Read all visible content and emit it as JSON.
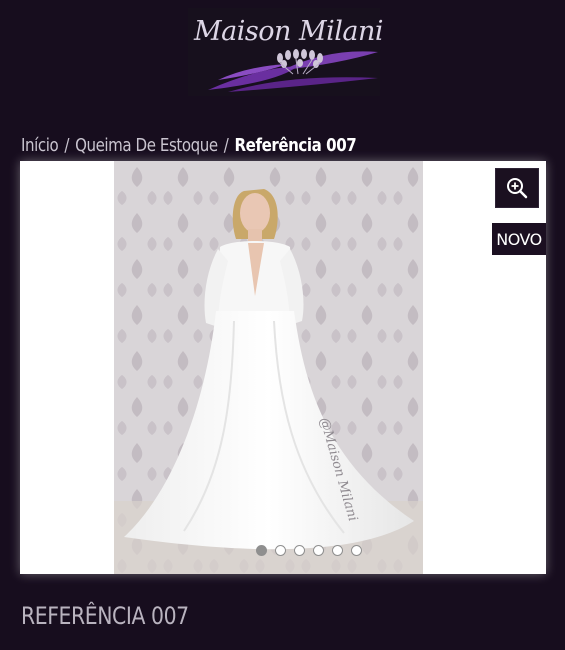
{
  "header": {
    "logo_text": "Maison Milani"
  },
  "breadcrumb": {
    "items": [
      "Início",
      "Queima De Estoque"
    ],
    "separator": "/",
    "current": "Referência 007"
  },
  "gallery": {
    "badge": "NOVO",
    "zoom_icon": "zoom-in-icon",
    "watermark": "@Maison Milani",
    "slide_count": 6,
    "active_slide": 1
  },
  "product": {
    "title": "REFERÊNCIA 007"
  },
  "colors": {
    "background": "#170d1e",
    "accent": "#7a3fb0",
    "badge_bg": "#1b0f21"
  }
}
